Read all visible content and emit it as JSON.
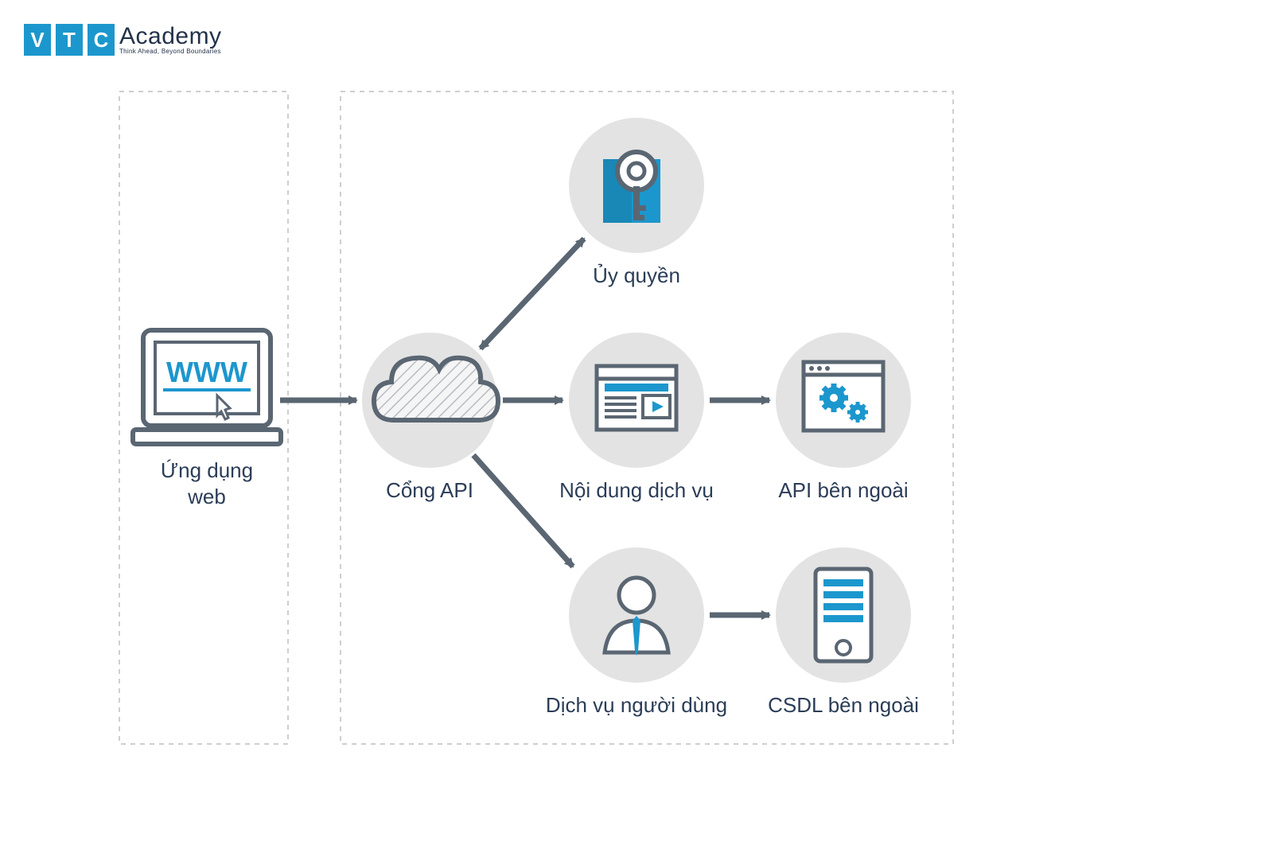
{
  "logo": {
    "letters": [
      "V",
      "T",
      "C"
    ],
    "word": "Academy",
    "tagline": "Think Ahead, Beyond Boundaries"
  },
  "laptop_text": "WWW",
  "nodes": {
    "webapp": "Ứng dụng\nweb",
    "gateway": "Cổng API",
    "auth": "Ủy quyền",
    "service_content": "Nội dung dịch vụ",
    "external_api": "API bên ngoài",
    "user_service": "Dịch vụ người dùng",
    "external_db": "CSDL bên ngoài"
  },
  "colors": {
    "brand_blue": "#1c97cd",
    "text": "#2b3d57",
    "stroke": "#5a6672",
    "node_bg": "#e3e3e3",
    "dashed": "#cfcfcf"
  }
}
